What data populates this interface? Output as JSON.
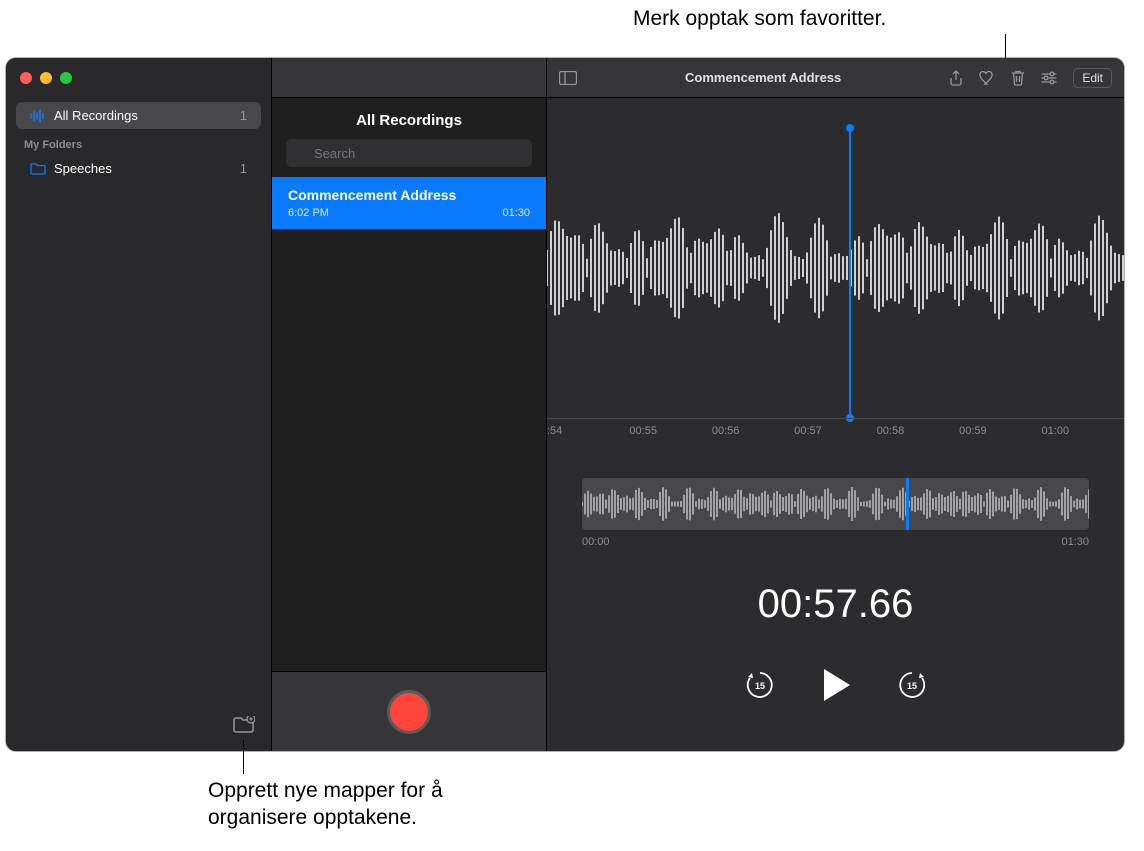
{
  "callouts": {
    "favorite": "Merk opptak som favoritter.",
    "new_folder_l1": "Opprett nye mapper for å",
    "new_folder_l2": "organisere opptakene."
  },
  "sidebar": {
    "all_recordings": "All Recordings",
    "all_count": "1",
    "my_folders": "My Folders",
    "folder_name": "Speeches",
    "folder_count": "1"
  },
  "list": {
    "title": "All Recordings",
    "search_placeholder": "Search",
    "item_title": "Commencement Address",
    "item_time": "6:02 PM",
    "item_dur": "01:30"
  },
  "toolbar": {
    "title": "Commencement Address",
    "edit": "Edit"
  },
  "ruler": {
    "t0": ":54",
    "t1": "00:55",
    "t2": "00:56",
    "t3": "00:57",
    "t4": "00:58",
    "t5": "00:59",
    "t6": "01:00"
  },
  "overview": {
    "start": "00:00",
    "end": "01:30"
  },
  "time_display": "00:57.66",
  "skip_back": "15",
  "skip_fwd": "15"
}
